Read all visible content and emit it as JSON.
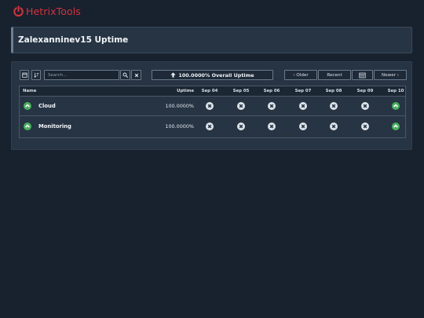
{
  "brand": {
    "name": "HetrixTools",
    "color": "#d6323c",
    "icon": "power-icon"
  },
  "page": {
    "title": "Zalexanninev15 Uptime"
  },
  "toolbar": {
    "search_placeholder": "Search...",
    "overall_uptime": "100.0000% Overall Uptime",
    "older_label": "‹ Older",
    "recent_label": "Recent",
    "newer_label": "Newer ›"
  },
  "table": {
    "headers": {
      "name": "Name",
      "uptime": "Uptime"
    },
    "days": [
      "Sep 04",
      "Sep 05",
      "Sep 06",
      "Sep 07",
      "Sep 08",
      "Sep 09",
      "Sep 10"
    ],
    "rows": [
      {
        "name": "Cloud",
        "uptime": "100.0000%",
        "status": "up",
        "days": [
          "none",
          "none",
          "none",
          "none",
          "none",
          "none",
          "up"
        ]
      },
      {
        "name": "Monitoring",
        "uptime": "100.0000%",
        "status": "up",
        "days": [
          "none",
          "none",
          "none",
          "none",
          "none",
          "none",
          "up"
        ]
      }
    ]
  },
  "colors": {
    "up": "#47b05a",
    "no_data": "#dde3e8",
    "background": "#18212e",
    "panel": "#263444"
  }
}
